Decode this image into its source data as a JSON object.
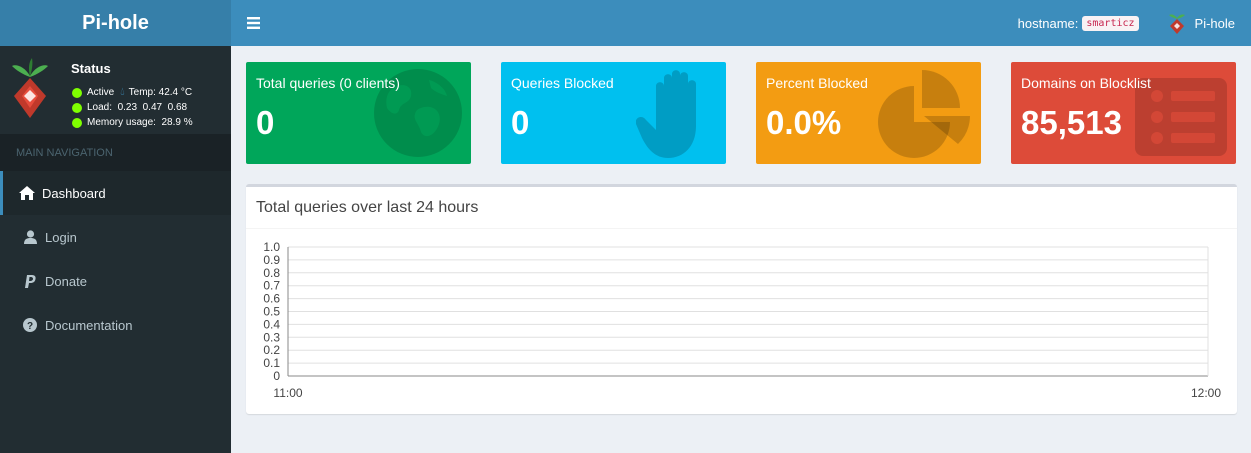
{
  "app": {
    "title": "Pi-hole"
  },
  "status": {
    "title": "Status",
    "active": "Active",
    "temp": "Temp: 42.4 °C",
    "load": "Load:  0.23  0.47  0.68",
    "memory": "Memory usage:  28.9 %"
  },
  "nav": {
    "header": "MAIN NAVIGATION",
    "items": [
      {
        "label": "Dashboard",
        "icon": "home-icon"
      },
      {
        "label": "Login",
        "icon": "user-icon"
      },
      {
        "label": "Donate",
        "icon": "paypal-icon"
      },
      {
        "label": "Documentation",
        "icon": "question-circle-icon"
      }
    ]
  },
  "topbar": {
    "hostname_label": "hostname:",
    "hostname": "smarticz",
    "user": "Pi-hole"
  },
  "stats": [
    {
      "label": "Total queries (0 clients)",
      "value": "0",
      "color": "#00a65a"
    },
    {
      "label": "Queries Blocked",
      "value": "0",
      "color": "#00c0ef"
    },
    {
      "label": "Percent Blocked",
      "value": "0.0%",
      "color": "#f39c12"
    },
    {
      "label": "Domains on Blocklist",
      "value": "85,513",
      "color": "#dd4b39"
    }
  ],
  "chart_data": {
    "type": "line",
    "title": "Total queries over last 24 hours",
    "x_ticks": [
      "11:00",
      "12:00"
    ],
    "y_ticks": [
      "0",
      "0.1",
      "0.2",
      "0.3",
      "0.4",
      "0.5",
      "0.6",
      "0.7",
      "0.8",
      "0.9",
      "1.0"
    ],
    "ylim": [
      0,
      1
    ],
    "grid": true,
    "series": []
  }
}
